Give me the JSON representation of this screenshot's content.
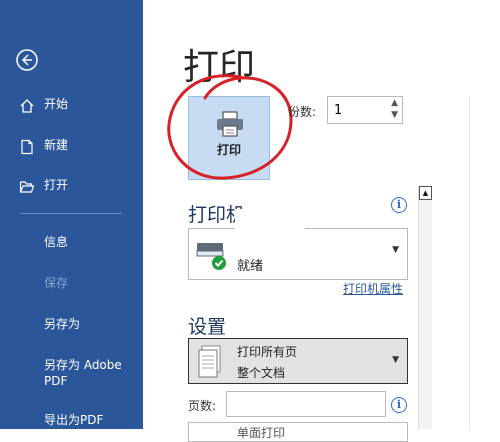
{
  "sidebar": {
    "items": [
      {
        "label": "开始"
      },
      {
        "label": "新建"
      },
      {
        "label": "打开"
      }
    ],
    "sub_items": [
      {
        "label": "信息"
      },
      {
        "label": "保存"
      },
      {
        "label": "另存为"
      },
      {
        "label": "另存为 Adobe PDF"
      },
      {
        "label": "导出为PDF"
      }
    ]
  },
  "main": {
    "title": "打印",
    "print_button_label": "打印",
    "copies_label": "份数:",
    "copies_value": "1",
    "printer_section": "打印机",
    "printer_status": "就绪",
    "printer_properties": "打印机属性",
    "settings_section": "设置",
    "settings_line1": "打印所有页",
    "settings_line2": "整个文档",
    "pages_label": "页数:",
    "next_dropdown": "单面打印"
  },
  "colors": {
    "sidebar_bg": "#2b579a",
    "accent": "#2b579a",
    "annotation_red": "#d92027",
    "print_button_bg": "#c7dcf2"
  }
}
